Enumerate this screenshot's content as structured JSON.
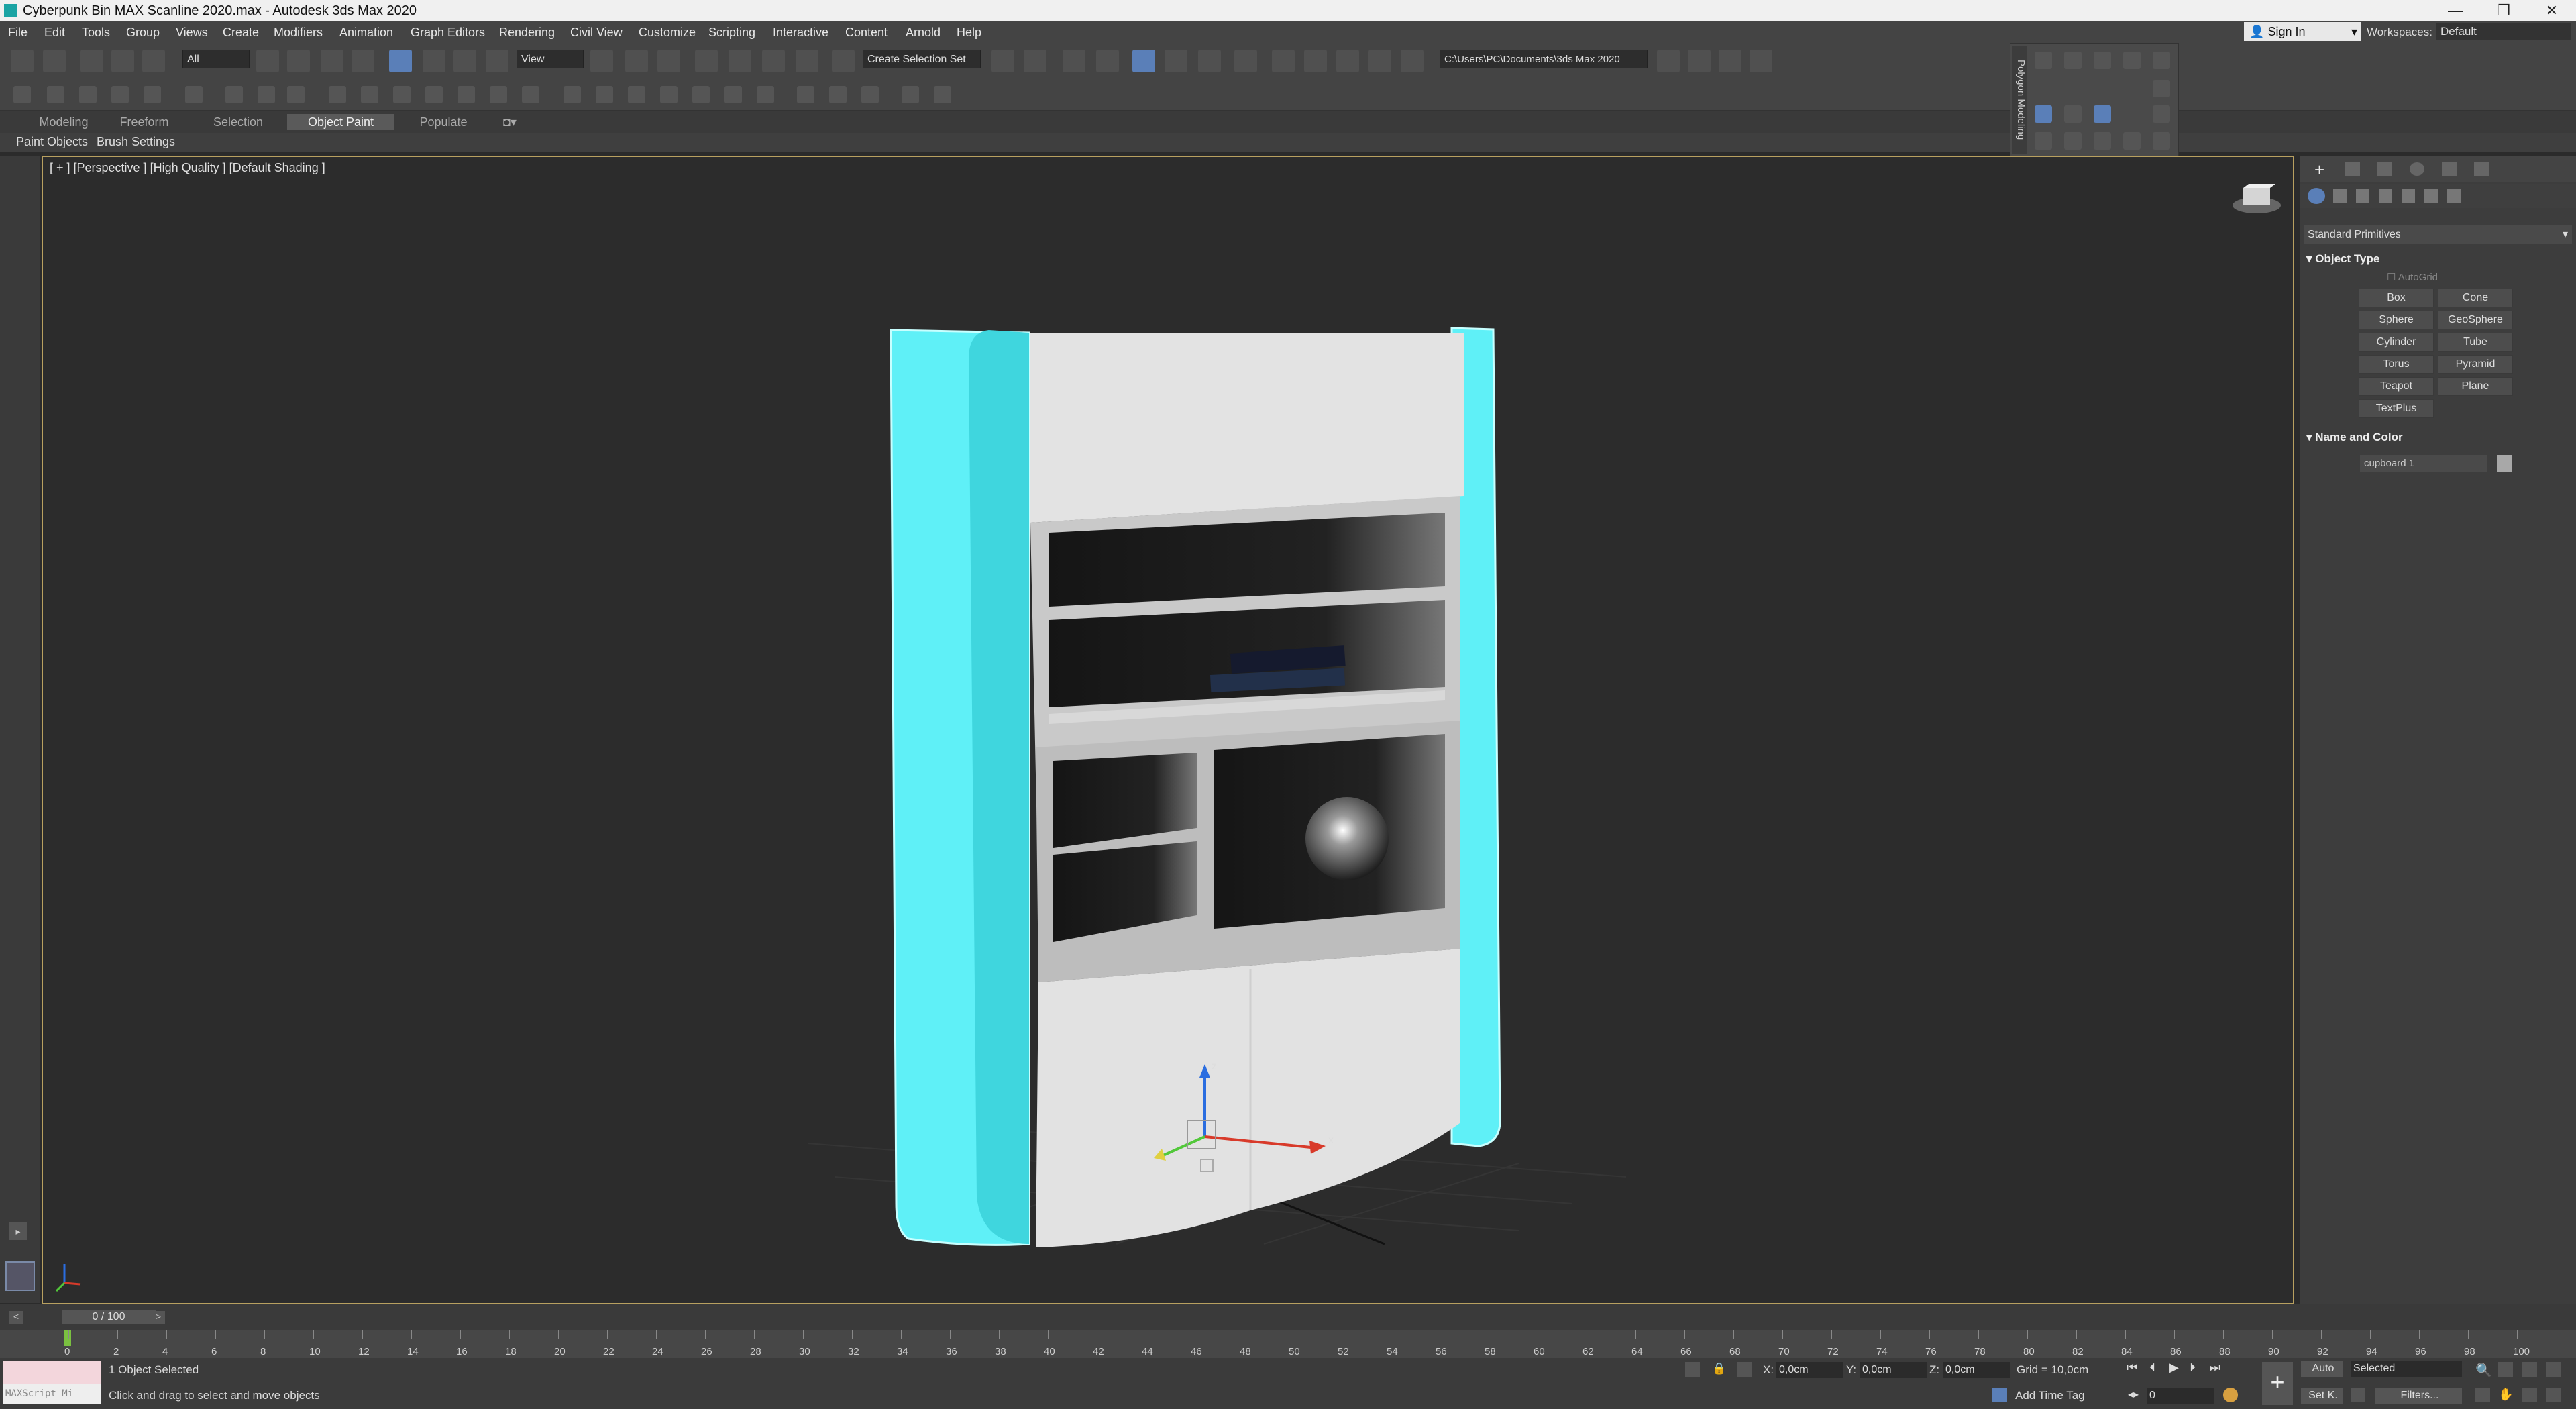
{
  "window": {
    "title": "Cyberpunk Bin MAX Scanline 2020.max - Autodesk 3ds Max 2020",
    "controls": [
      "—",
      "❐",
      "✕"
    ]
  },
  "menu": [
    "File",
    "Edit",
    "Tools",
    "Group",
    "Views",
    "Create",
    "Modifiers",
    "Animation",
    "Graph Editors",
    "Rendering",
    "Civil View",
    "Customize",
    "Scripting",
    "Interactive",
    "Content",
    "Arnold",
    "Help"
  ],
  "account": {
    "signin": "Sign In",
    "workspaces_label": "Workspaces:",
    "workspace": "Default"
  },
  "toolbar": {
    "selection_filter": "All",
    "ref_coord": "View",
    "selection_set": "Create Selection Set",
    "project_path": "C:\\Users\\PC\\Documents\\3ds Max 2020"
  },
  "ribbon": {
    "tabs": [
      "Modeling",
      "Freeform",
      "Selection",
      "Object Paint",
      "Populate"
    ],
    "active_tab": "Object Paint",
    "sub_items": [
      "Paint Objects",
      "Brush Settings"
    ]
  },
  "floating_panel": {
    "label": "Polygon Modeling"
  },
  "viewport": {
    "label": "[ + ] [Perspective ] [High Quality ] [Default Shading ]",
    "axis": {
      "x": "x",
      "y": "y",
      "z": "z"
    },
    "colors": {
      "selection_outline": "#5ff0f7",
      "cupboard": "#e2e2e2",
      "shelf_interior": "#1a1a1a"
    }
  },
  "command_panel": {
    "category": "Standard Primitives",
    "object_type_title": "Object Type",
    "autogrid": "AutoGrid",
    "buttons": [
      "Box",
      "Cone",
      "Sphere",
      "GeoSphere",
      "Cylinder",
      "Tube",
      "Torus",
      "Pyramid",
      "Teapot",
      "Plane",
      "TextPlus"
    ],
    "name_color_title": "Name and Color",
    "object_name": "cupboard 1"
  },
  "timeline": {
    "slider": "0 / 100",
    "ticks": [
      "0",
      "2",
      "4",
      "6",
      "8",
      "10",
      "12",
      "14",
      "16",
      "18",
      "20",
      "22",
      "24",
      "26",
      "28",
      "30",
      "32",
      "34",
      "36",
      "38",
      "40",
      "42",
      "44",
      "46",
      "48",
      "50",
      "52",
      "54",
      "56",
      "58",
      "60",
      "62",
      "64",
      "66",
      "68",
      "70",
      "72",
      "74",
      "76",
      "78",
      "80",
      "82",
      "84",
      "86",
      "88",
      "90",
      "92",
      "94",
      "96",
      "98",
      "100"
    ]
  },
  "status": {
    "maxscript": "MAXScript Mi",
    "selection": "1 Object Selected",
    "prompt": "Click and drag to select and move objects",
    "x_label": "X:",
    "x_value": "0,0cm",
    "y_label": "Y:",
    "y_value": "0,0cm",
    "z_label": "Z:",
    "z_value": "0,0cm",
    "grid": "Grid = 10,0cm",
    "add_time_tag": "Add Time Tag",
    "auto": "Auto",
    "set_key": "Set K.",
    "key_filter": "Selected",
    "filters": "Filters...",
    "frame": "0"
  }
}
